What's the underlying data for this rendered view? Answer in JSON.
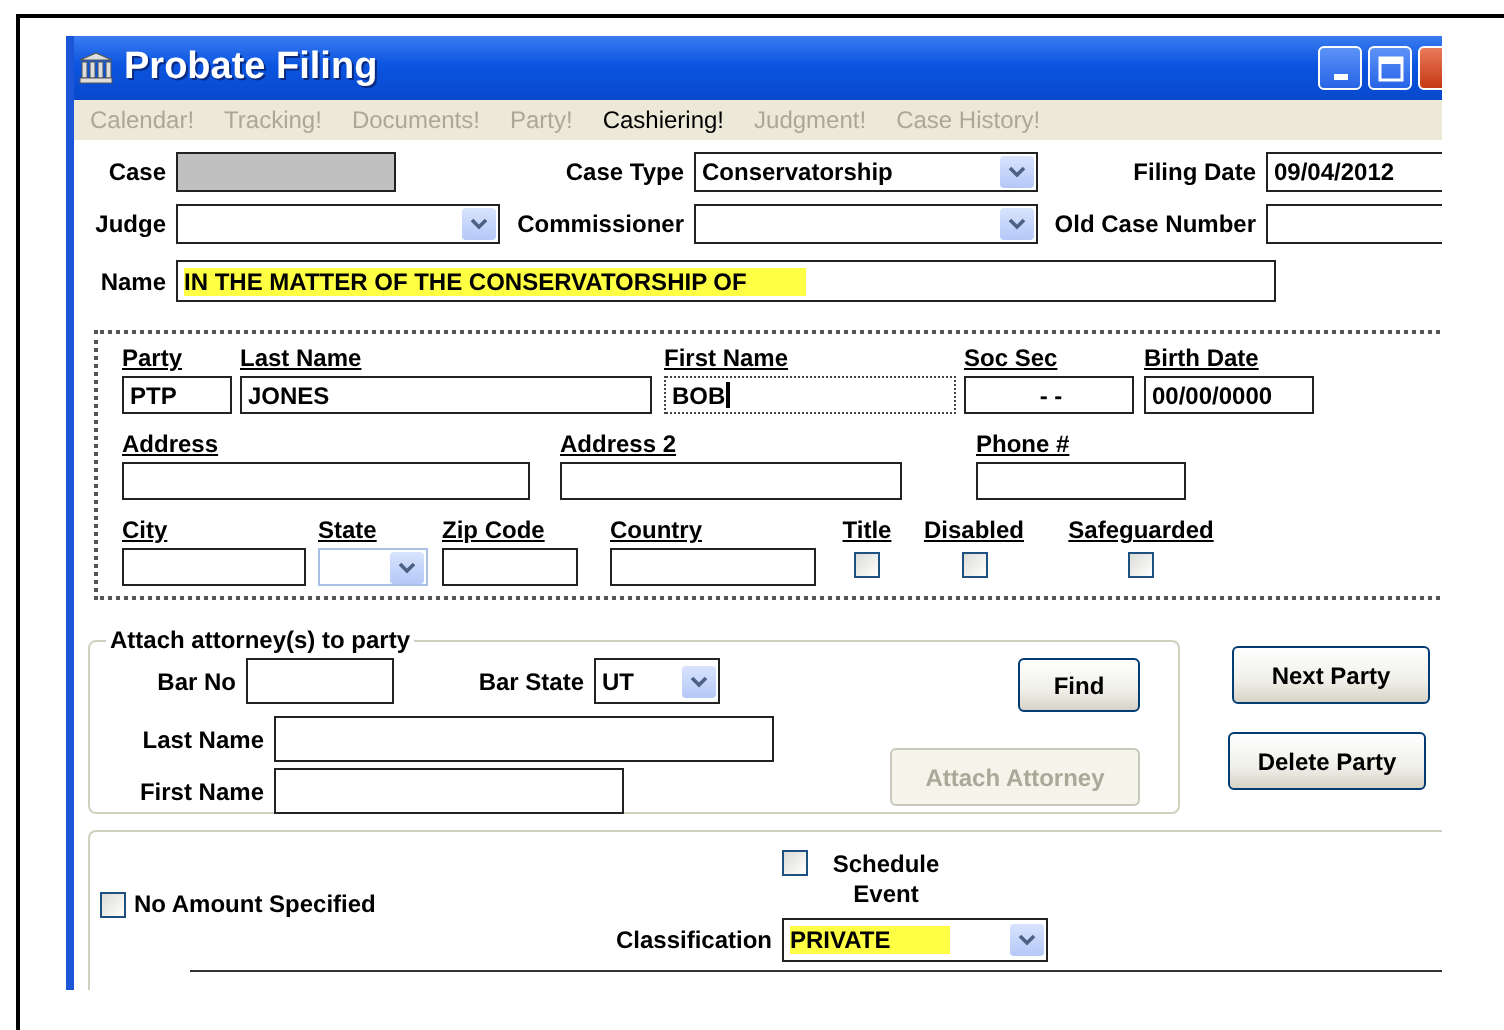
{
  "window": {
    "title": "Probate Filing"
  },
  "menu": [
    {
      "label": "Calendar!",
      "disabled": true
    },
    {
      "label": "Tracking!",
      "disabled": true
    },
    {
      "label": "Documents!",
      "disabled": true
    },
    {
      "label": "Party!",
      "disabled": true
    },
    {
      "label": "Cashiering!",
      "disabled": false
    },
    {
      "label": "Judgment!",
      "disabled": true
    },
    {
      "label": "Case History!",
      "disabled": true
    }
  ],
  "header_rows": [
    [
      {
        "label": "Case",
        "kind": "text",
        "disabled": true
      },
      {
        "label": "Case Type",
        "kind": "select",
        "value": "Conservatorship",
        "disabled": false
      },
      {
        "label": "Filing Date",
        "kind": "text",
        "value": "09/04/2012",
        "disabled": false
      }
    ],
    [
      {
        "label": "Judge",
        "kind": "select",
        "disabled": false
      },
      {
        "label": "Commissioner",
        "kind": "select",
        "disabled": false
      },
      {
        "label": "Old Case Number",
        "kind": "text",
        "disabled": false
      }
    ]
  ],
  "name": {
    "label": "Name",
    "value": "IN THE MATTER OF THE CONSERVATORSHIP OF",
    "highlighted": true
  },
  "party": {
    "rows": [
      [
        {
          "label": "Party",
          "kind": "text",
          "value": "PTP",
          "focused": false
        },
        {
          "label": "Last Name",
          "kind": "text",
          "value": "JONES",
          "focused": false
        },
        {
          "label": "First Name",
          "kind": "text",
          "value": "BOB",
          "focused": true
        },
        {
          "label": "Soc Sec",
          "kind": "text",
          "value": "- -",
          "focused": false
        },
        {
          "label": "Birth Date",
          "kind": "text",
          "value": "00/00/0000",
          "focused": false
        }
      ],
      [
        {
          "label": "Address",
          "kind": "text",
          "focused": false
        },
        {
          "label": "Address 2",
          "kind": "text",
          "focused": false
        },
        {
          "label": "Phone #",
          "kind": "text",
          "focused": false
        }
      ],
      [
        {
          "label": "City",
          "kind": "text",
          "focused": false
        },
        {
          "label": "State",
          "kind": "select",
          "focused": false
        },
        {
          "label": "Zip Code",
          "kind": "text",
          "focused": false
        },
        {
          "label": "Country",
          "kind": "text",
          "focused": false
        },
        {
          "label": "Title",
          "kind": "checkbox",
          "checked": false
        },
        {
          "label": "Disabled",
          "kind": "checkbox",
          "checked": false
        },
        {
          "label": "Safeguarded",
          "kind": "checkbox",
          "checked": false
        }
      ]
    ]
  },
  "attorney": {
    "legend": "Attach attorney(s) to party",
    "fields": [
      {
        "label": "Bar No",
        "kind": "text"
      },
      {
        "label": "Bar State",
        "kind": "select",
        "value": "UT"
      },
      {
        "label": "Last Name",
        "kind": "text"
      },
      {
        "label": "First Name",
        "kind": "text"
      }
    ],
    "buttons": [
      {
        "label": "Find",
        "disabled": false
      },
      {
        "label": "Attach Attorney",
        "disabled": true
      }
    ]
  },
  "party_buttons": [
    {
      "label": "Next Party"
    },
    {
      "label": "Delete Party"
    }
  ],
  "options": {
    "no_amount": {
      "label": "No Amount Specified",
      "checked": false
    },
    "schedule_event": {
      "label": "Schedule Event",
      "checked": false
    },
    "classification": {
      "label": "Classification",
      "value": "PRIVATE",
      "highlighted": true
    }
  }
}
